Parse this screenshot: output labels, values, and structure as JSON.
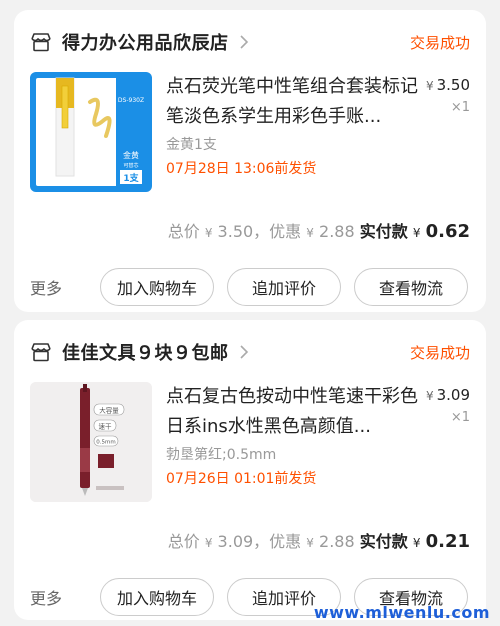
{
  "orders": [
    {
      "shop_name": "得力办公用品欣辰店",
      "status": "交易成功",
      "product": {
        "title": "点石荧光笔中性笔组合套装标记笔淡色系学生用彩色手账...",
        "price_symbol": "¥",
        "price": "3.50",
        "quantity": "×1",
        "sku": "金黄1支",
        "ship_note": "07月28日 13:06前发货",
        "thumb_text": {
          "code": "DS-930Z",
          "color": "金黄",
          "sub": "可替芯",
          "count": "1支"
        }
      },
      "totals": {
        "total_label": "总价",
        "total_symbol": "¥",
        "total_value": "3.50",
        "discount_label": "，优惠",
        "discount_symbol": "¥",
        "discount_value": "2.88",
        "paid_label": "实付款",
        "paid_symbol": "¥",
        "paid_value": "0.62"
      },
      "actions": {
        "more": "更多",
        "add_cart": "加入购物车",
        "review": "追加评价",
        "logistics": "查看物流"
      }
    },
    {
      "shop_name": "佳佳文具９块９包邮",
      "status": "交易成功",
      "product": {
        "title": "点石复古色按动中性笔速干彩色日系ins水性黑色高颜值...",
        "price_symbol": "¥",
        "price": "3.09",
        "quantity": "×1",
        "sku": "勃垦第红;0.5mm",
        "ship_note": "07月26日 01:01前发货",
        "thumb_text": {
          "tag1": "大容量",
          "tag2": "速干",
          "tag3": "0.5mm"
        }
      },
      "totals": {
        "total_label": "总价",
        "total_symbol": "¥",
        "total_value": "3.09",
        "discount_label": "，优惠",
        "discount_symbol": "¥",
        "discount_value": "2.88",
        "paid_label": "实付款",
        "paid_symbol": "¥",
        "paid_value": "0.21"
      },
      "actions": {
        "more": "更多",
        "add_cart": "加入购物车",
        "review": "追加评价",
        "logistics": "查看物流"
      }
    }
  ],
  "watermark": "www.mlwenlu.com",
  "colors": {
    "accent": "#ff5000",
    "background": "#f2f2f2",
    "thumb1_bg": "#1b8fe6",
    "pen2_body": "#7a1f2b"
  },
  "icons": {
    "store": "store-icon",
    "chevron": "chevron-right-icon"
  }
}
